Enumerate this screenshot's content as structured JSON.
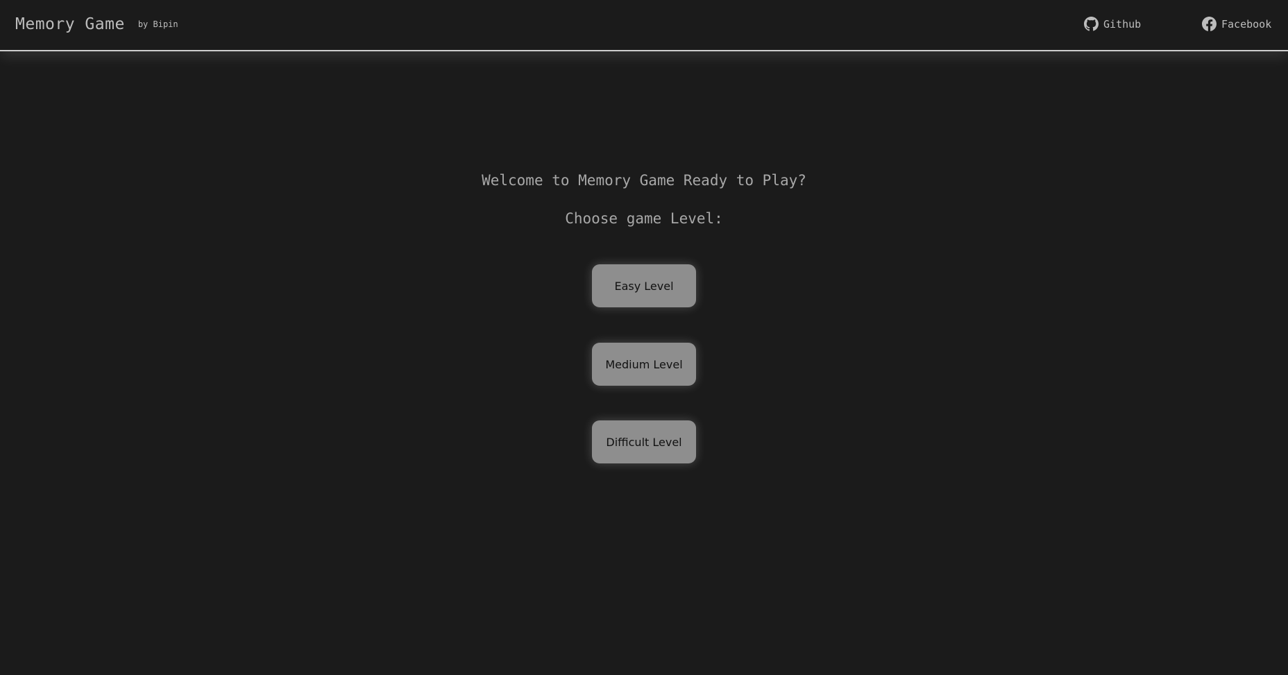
{
  "header": {
    "title": "Memory Game",
    "byline": "by Bipin",
    "links": [
      {
        "label": "Github",
        "icon": "github-icon"
      },
      {
        "label": "Facebook",
        "icon": "facebook-icon"
      }
    ]
  },
  "main": {
    "welcome": "Welcome to Memory Game Ready to Play?",
    "choose": "Choose game Level:",
    "levels": [
      {
        "label": "Easy Level"
      },
      {
        "label": "Medium Level"
      },
      {
        "label": "Difficult Level"
      }
    ]
  },
  "colors": {
    "background": "#1b1b1b",
    "text": "#bdbdbd",
    "button": "#8e8e8e",
    "divider": "#cfcfcf"
  }
}
